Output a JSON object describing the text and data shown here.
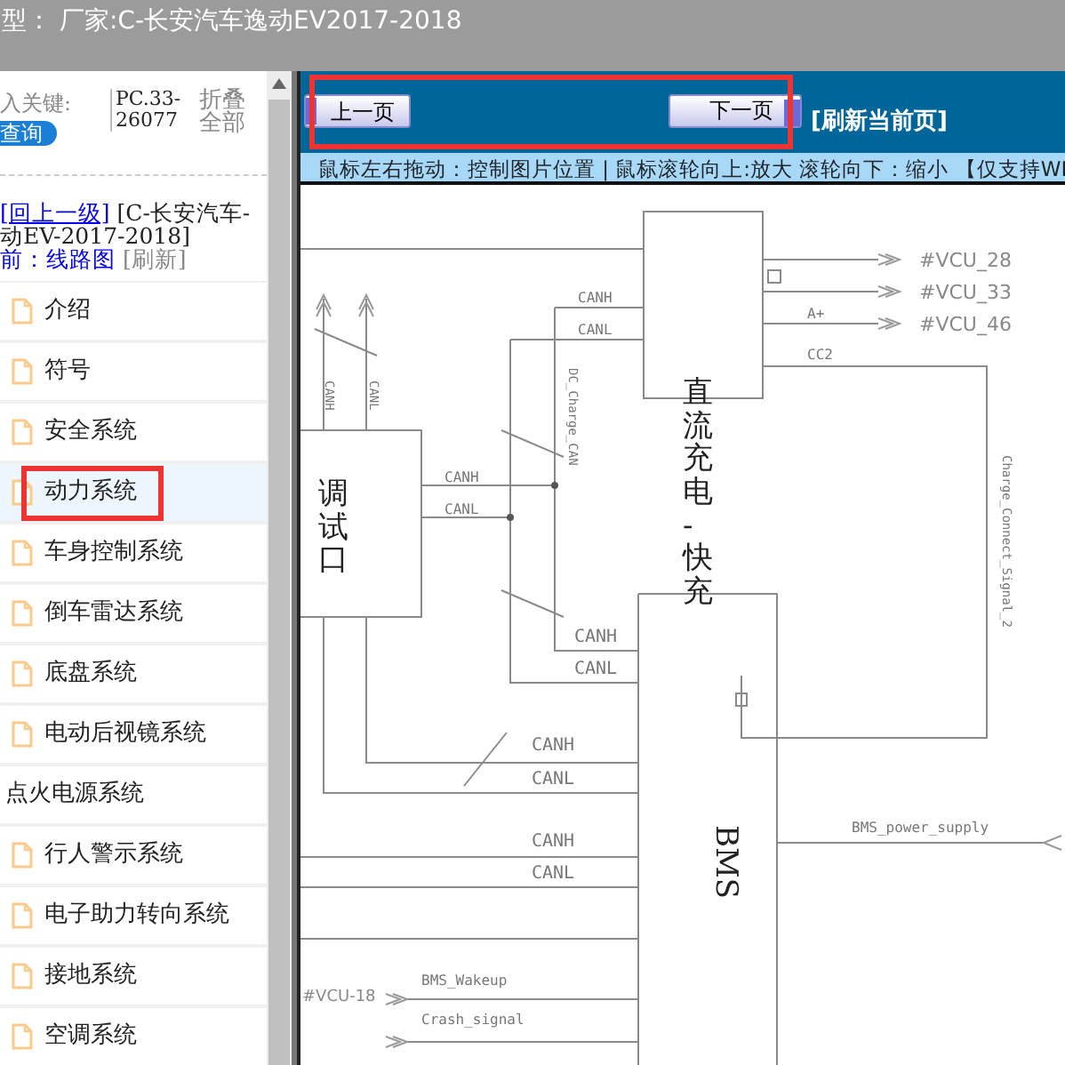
{
  "title_bar": {
    "title": "型：  厂家:C-长安汽车逸动EV2017-2018"
  },
  "search": {
    "label": "入关键:",
    "value": "PC.33-26077",
    "collapse_all": "折叠全部",
    "query_button": "查询"
  },
  "breadcrumb": {
    "up_link": "[回上一级]",
    "path": "[C-长安汽车-动EV-2017-2018]",
    "current_link": "前：线路图",
    "refresh": "[刷新]"
  },
  "tree": [
    {
      "label": "介绍",
      "kind": "file",
      "selected": false,
      "highlighted": false
    },
    {
      "label": "符号",
      "kind": "file",
      "selected": false,
      "highlighted": false
    },
    {
      "label": "安全系统",
      "kind": "file",
      "selected": false,
      "highlighted": false
    },
    {
      "label": "动力系统",
      "kind": "file",
      "selected": true,
      "highlighted": true
    },
    {
      "label": "车身控制系统",
      "kind": "file",
      "selected": false,
      "highlighted": false
    },
    {
      "label": "倒车雷达系统",
      "kind": "file",
      "selected": false,
      "highlighted": false
    },
    {
      "label": "底盘系统",
      "kind": "file",
      "selected": false,
      "highlighted": false
    },
    {
      "label": "电动后视镜系统",
      "kind": "file",
      "selected": false,
      "highlighted": false
    },
    {
      "label": "点火电源系统",
      "kind": "folder",
      "selected": false,
      "highlighted": false
    },
    {
      "label": "行人警示系统",
      "kind": "file",
      "selected": false,
      "highlighted": false
    },
    {
      "label": "电子助力转向系统",
      "kind": "file",
      "selected": false,
      "highlighted": false
    },
    {
      "label": "接地系统",
      "kind": "file",
      "selected": false,
      "highlighted": false
    },
    {
      "label": "空调系统",
      "kind": "file",
      "selected": false,
      "highlighted": false
    }
  ],
  "toolbar": {
    "prev_button": "上一页",
    "next_button": "下一页",
    "refresh_link": "[刷新当前页]",
    "highlighted": true
  },
  "hint_bar": "鼠标左右拖动：控制图片位置 | 鼠标滚轮向上:放大  滚轮向下：缩小 【仅支持WI",
  "diagram": {
    "labels": [
      {
        "text": "直流充电-快充",
        "kind": "block"
      },
      {
        "text": "CANH",
        "kind": "signal"
      },
      {
        "text": "CANL",
        "kind": "signal"
      },
      {
        "text": "#VCU_28",
        "kind": "ref"
      },
      {
        "text": "#VCU_33",
        "kind": "ref"
      },
      {
        "text": "#VCU_46",
        "kind": "ref"
      },
      {
        "text": "A+",
        "kind": "signal"
      },
      {
        "text": "CC2",
        "kind": "signal"
      },
      {
        "text": "DC_Charge_CAN",
        "kind": "wire"
      },
      {
        "text": "Charge_Connect_Signal_2",
        "kind": "wire"
      },
      {
        "text": "调试口",
        "kind": "block"
      },
      {
        "text": "CANH",
        "kind": "signal"
      },
      {
        "text": "CANL",
        "kind": "signal"
      },
      {
        "text": "CANH",
        "kind": "wire"
      },
      {
        "text": "CANL",
        "kind": "wire"
      },
      {
        "text": "BMS",
        "kind": "block"
      },
      {
        "text": "CANH",
        "kind": "signal"
      },
      {
        "text": "CANL",
        "kind": "signal"
      },
      {
        "text": "CANH",
        "kind": "signal"
      },
      {
        "text": "CANL",
        "kind": "signal"
      },
      {
        "text": "CANH",
        "kind": "signal"
      },
      {
        "text": "CANL",
        "kind": "signal"
      },
      {
        "text": "BMS_power_supply",
        "kind": "signal"
      },
      {
        "text": "BMS_Wakeup",
        "kind": "signal"
      },
      {
        "text": "Crash_signal",
        "kind": "signal"
      },
      {
        "text": "#VCU-18",
        "kind": "ref"
      }
    ]
  }
}
